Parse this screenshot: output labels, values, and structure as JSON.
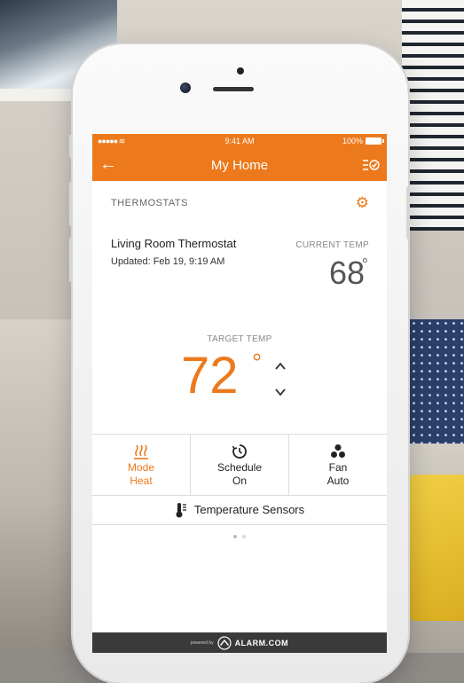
{
  "status_bar": {
    "signal": "●●●●● ",
    "time": "9:41 AM",
    "battery": "100%"
  },
  "nav": {
    "back_icon": "arrow-left-icon",
    "title": "My Home",
    "right_icon": "list-check-icon"
  },
  "section": {
    "title": "THERMOSTATS",
    "settings_icon": "gear-icon"
  },
  "thermostat": {
    "name": "Living Room Thermostat",
    "updated": "Updated: Feb 19, 9:19 AM",
    "current_label": "CURRENT TEMP",
    "current_value": "68",
    "current_unit": "°",
    "target_label": "TARGET TEMP",
    "target_value": "72",
    "target_unit": "°"
  },
  "controls": [
    {
      "icon": "heat-icon",
      "line1": "Mode",
      "line2": "Heat",
      "active": true
    },
    {
      "icon": "schedule-clock-icon",
      "line1": "Schedule",
      "line2": "On",
      "active": false
    },
    {
      "icon": "fan-icon",
      "line1": "Fan",
      "line2": "Auto",
      "active": false
    }
  ],
  "sensors_link": {
    "icon": "thermometer-icon",
    "label": "Temperature Sensors"
  },
  "pager": {
    "total": 2,
    "current": 1
  },
  "footer": {
    "powered_by": "powered by",
    "brand": "ALARM.COM"
  },
  "colors": {
    "accent": "#ec7a1c",
    "footer_bg": "#3a3a3a"
  }
}
